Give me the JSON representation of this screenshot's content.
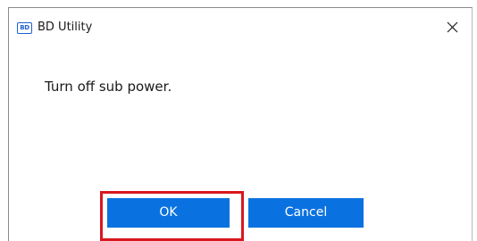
{
  "window": {
    "title": "BD Utility",
    "app_icon_text": "BD",
    "close_icon": "close-icon"
  },
  "dialog": {
    "message": "Turn off sub power."
  },
  "buttons": {
    "ok_label": "OK",
    "cancel_label": "Cancel"
  },
  "colors": {
    "button_primary": "#0a72e0",
    "highlight": "#d9171e",
    "icon_accent": "#1f5fcf"
  }
}
